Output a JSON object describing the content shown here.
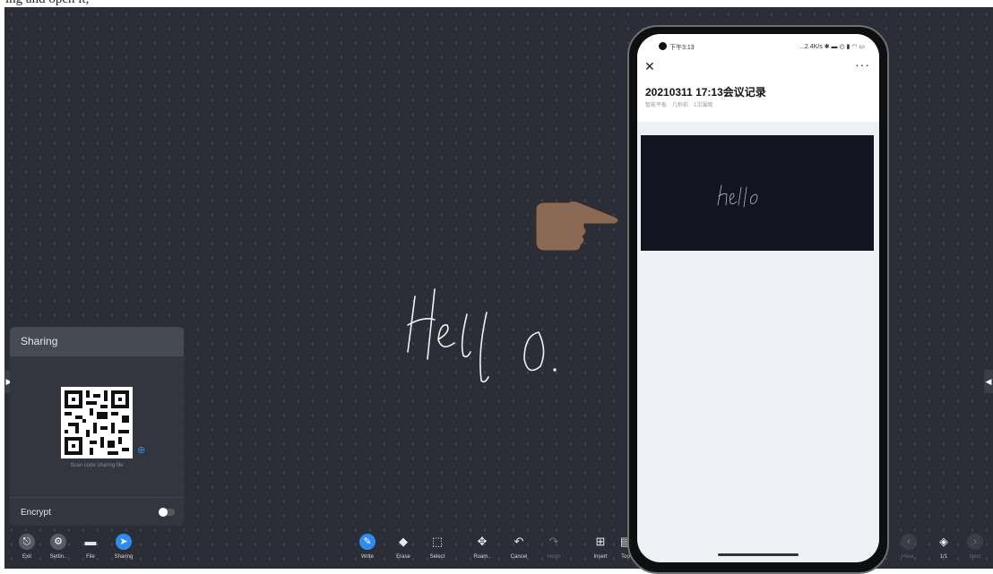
{
  "caption": "ing and open it,",
  "sharing": {
    "title": "Sharing",
    "scan_text": "Scan code sharing file",
    "encrypt_label": "Encrypt"
  },
  "toolbar_left": [
    {
      "label": "Exit",
      "icon": "exit-icon"
    },
    {
      "label": "Settin..",
      "icon": "settings-icon"
    },
    {
      "label": "File",
      "icon": "folder-icon"
    },
    {
      "label": "Sharing",
      "icon": "share-icon"
    }
  ],
  "toolbar_center": [
    {
      "label": "Write",
      "icon": "pen-icon"
    },
    {
      "label": "Erase",
      "icon": "eraser-icon"
    },
    {
      "label": "Select",
      "icon": "select-icon"
    },
    {
      "label": "Roam..",
      "icon": "roam-icon"
    },
    {
      "label": "Cancel",
      "icon": "undo-icon"
    },
    {
      "label": "Redo",
      "icon": "redo-icon"
    },
    {
      "label": "Insert",
      "icon": "insert-icon"
    },
    {
      "label": "Too",
      "icon": "tools-icon"
    }
  ],
  "toolbar_right": [
    {
      "label": "Previ..",
      "icon": "prev-icon"
    },
    {
      "label": "1/1",
      "icon": "pages-icon"
    },
    {
      "label": "Next",
      "icon": "next-icon"
    }
  ],
  "board_text": "Hello",
  "phone": {
    "time": "下午3:13",
    "status_right": "...2.4K/s",
    "doc_title": "20210311 17:13会议记录",
    "meta": [
      "智能平板",
      "几秒前",
      "1次围观"
    ],
    "preview_text": "hello"
  },
  "colors": {
    "accent": "#2d8cf0",
    "board": "#2b2e36"
  }
}
